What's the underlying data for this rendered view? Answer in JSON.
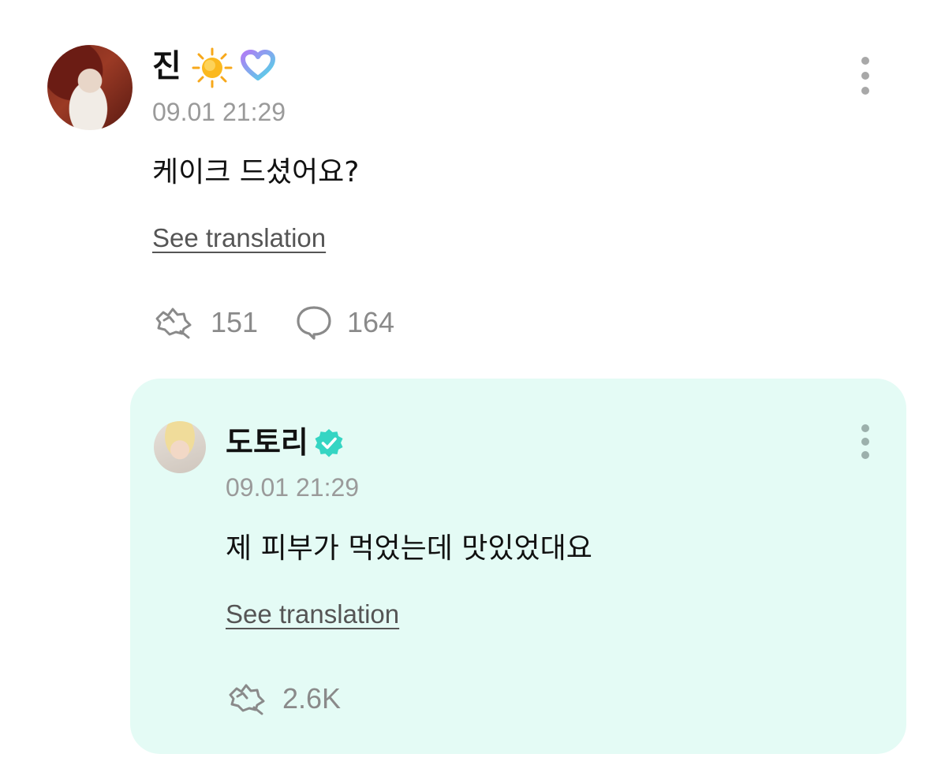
{
  "post": {
    "author": "진",
    "author_icons": [
      "sun-emoji-icon",
      "weverse-heart-icon"
    ],
    "timestamp": "09.01 21:29",
    "text": "케이크 드셨어요?",
    "see_translation": "See translation",
    "likes": "151",
    "comments": "164"
  },
  "reply": {
    "author": "도토리",
    "author_badge": "verified-badge-icon",
    "timestamp": "09.01 21:29",
    "text": "제 피부가 먹었는데 맛있었대요",
    "see_translation": "See translation",
    "likes": "2.6K"
  },
  "colors": {
    "reply_background": "#e4fbf5",
    "verified_badge": "#35d5c3",
    "heart_gradient": [
      "#b07cf5",
      "#4fd8e6"
    ],
    "muted_text": "#9a9a9a"
  }
}
